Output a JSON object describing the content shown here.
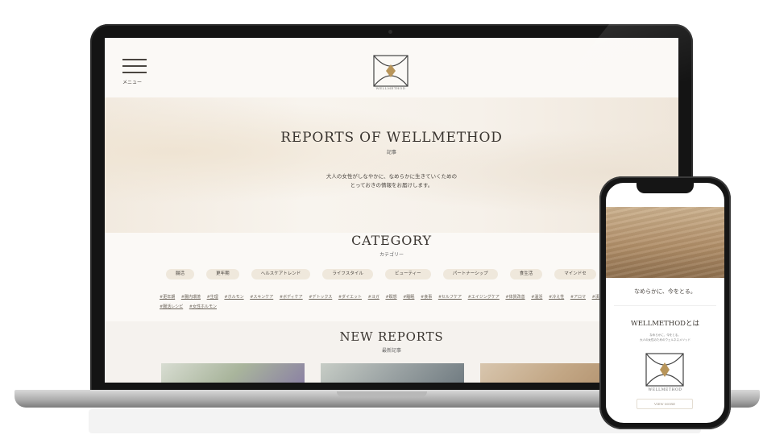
{
  "header": {
    "menu_label": "メニュー",
    "logo_caption": "WELLMETHOD"
  },
  "hero": {
    "title": "REPORTS OF WELLMETHOD",
    "subtitle": "記事",
    "description_line1": "大人の女性がしなやかに、なめらかに生きていくための",
    "description_line2": "とっておきの情報をお届けします。"
  },
  "category": {
    "title": "CATEGORY",
    "subtitle": "カテゴリー",
    "chips": [
      "腸活",
      "更年期",
      "ヘルスケアトレンド",
      "ライフスタイル",
      "ビューティー",
      "パートナーシップ",
      "食生活",
      "マインドセ"
    ],
    "tags": [
      "#更年期",
      "#腸内環境",
      "#生理",
      "#ホルモン",
      "#スキンケア",
      "#ボディケア",
      "#デトックス",
      "#ダイエット",
      "#ヨガ",
      "#瞑想",
      "#睡眠",
      "#食事",
      "#セルフケア",
      "#エイジングケア",
      "#体質改善",
      "#温活",
      "#冷え性",
      "#アロマ",
      "#漢方",
      "#腸活レシピ",
      "#女性ホルモン"
    ]
  },
  "new_reports": {
    "title": "NEW REPORTS",
    "subtitle": "最新記事"
  },
  "phone": {
    "tagline": "なめらかに、今をとる。",
    "about_title": "WELLMETHODとは",
    "about_line1": "なめらかに、今をとる。",
    "about_line2": "大人の女性のためのウェルネスメソッド",
    "logo_caption": "WELLMETHOD",
    "button_label": "VIEW MORE"
  },
  "colors": {
    "accent_gold": "#b8955a",
    "chip_bg": "#efe8dc",
    "text": "#3a3530"
  }
}
